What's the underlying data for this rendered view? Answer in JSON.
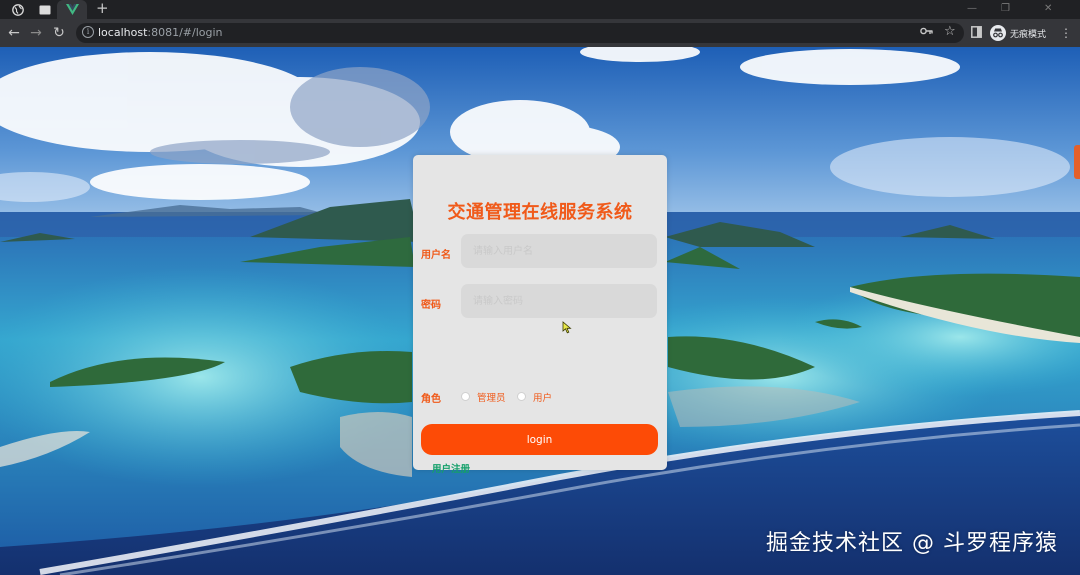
{
  "browser": {
    "tabs": [
      {
        "icon": "globe-icon"
      },
      {
        "icon": "window-icon"
      },
      {
        "icon": "vue-logo-icon",
        "active": true
      }
    ],
    "new_tab_label": "+",
    "window_controls": {
      "minimize": "—",
      "maximize": "❐",
      "close": "✕"
    },
    "url_host": "localhost",
    "url_rest": ":8081/#/login",
    "incognito_label": "无痕模式"
  },
  "login": {
    "title": "交通管理在线服务系统",
    "username_label": "用户名",
    "username_placeholder": "请输入用户名",
    "password_label": "密码",
    "password_placeholder": "请输入密码",
    "role_label": "角色",
    "roles": [
      "管理员",
      "用户"
    ],
    "login_button": "login",
    "register_link": "用户注册"
  },
  "watermark": "掘金技术社区 @ 斗罗程序猿",
  "colors": {
    "accent": "#f05a1a",
    "button": "#fd4b06",
    "link": "#14a06a",
    "card": "#e5e5e5"
  }
}
